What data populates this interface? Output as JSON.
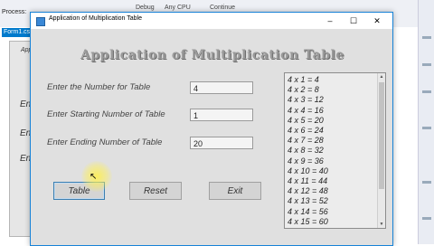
{
  "vs": {
    "process_label": "Process:",
    "tab_label": "Form1.cs",
    "toolbar_items": [
      "Debug",
      "Any CPU",
      "Continue"
    ],
    "bg_labels": [
      "Ente",
      "Ente",
      "Ente"
    ],
    "bg_form_label": "Applic"
  },
  "window": {
    "title": "Application of Multiplication Table",
    "minimize_glyph": "–",
    "maximize_glyph": "☐",
    "close_glyph": "✕"
  },
  "heading": "Application of Multiplication Table",
  "fields": {
    "number_label": "Enter the Number for Table",
    "number_value": "4",
    "start_label": "Enter Starting Number of Table",
    "start_value": "1",
    "end_label": "Enter Ending Number of Table",
    "end_value": "20"
  },
  "buttons": {
    "table": "Table",
    "reset": "Reset",
    "exit": "Exit"
  },
  "results": [
    "4 x 1 = 4",
    "4 x 2 = 8",
    "4 x 3 = 12",
    "4 x 4 = 16",
    "4 x 5 = 20",
    "4 x 6 = 24",
    "4 x 7 = 28",
    "4 x 8 = 32",
    "4 x 9 = 36",
    "4 x 10 = 40",
    "4 x 11 = 44",
    "4 x 12 = 48",
    "4 x 13 = 52",
    "4 x 14 = 56",
    "4 x 15 = 60"
  ],
  "icons": {
    "scroll_up": "▲",
    "scroll_down": "▼",
    "cursor": "↖"
  }
}
